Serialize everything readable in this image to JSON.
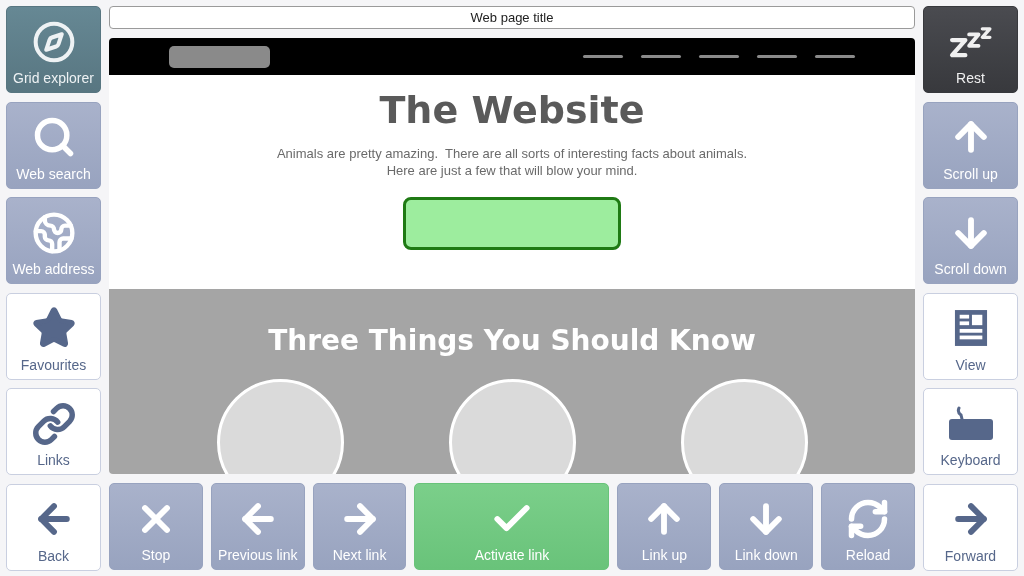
{
  "left_panel": [
    {
      "label": "Grid explorer",
      "kind": "dark"
    },
    {
      "label": "Web search",
      "kind": "inactive"
    },
    {
      "label": "Web address",
      "kind": "inactive"
    },
    {
      "label": "Favourites",
      "kind": "normal"
    },
    {
      "label": "Links",
      "kind": "normal"
    },
    {
      "label": "Back",
      "kind": "normal"
    }
  ],
  "browser": {
    "title_field": "Web page title",
    "page": {
      "heading": "The Website",
      "intro": "Animals are pretty amazing.  There are all sorts of interesting facts about animals.  Here are just a few that will blow your mind.",
      "link_button": {
        "highlighted": true
      },
      "section_heading": "Three Things You Should Know"
    }
  },
  "toolbar": [
    {
      "label": "Stop",
      "kind": "inactive"
    },
    {
      "label": "Previous link",
      "kind": "inactive"
    },
    {
      "label": "Next link",
      "kind": "inactive"
    },
    {
      "label": "Activate link",
      "kind": "primary"
    },
    {
      "label": "Link up",
      "kind": "inactive"
    },
    {
      "label": "Link down",
      "kind": "inactive"
    },
    {
      "label": "Reload",
      "kind": "inactive"
    }
  ],
  "right_panel": [
    {
      "label": "Rest",
      "kind": "black"
    },
    {
      "label": "Scroll up",
      "kind": "inactive"
    },
    {
      "label": "Scroll down",
      "kind": "inactive"
    },
    {
      "label": "View",
      "kind": "normal"
    },
    {
      "label": "Keyboard",
      "kind": "normal"
    },
    {
      "label": "Forward",
      "kind": "normal"
    }
  ]
}
